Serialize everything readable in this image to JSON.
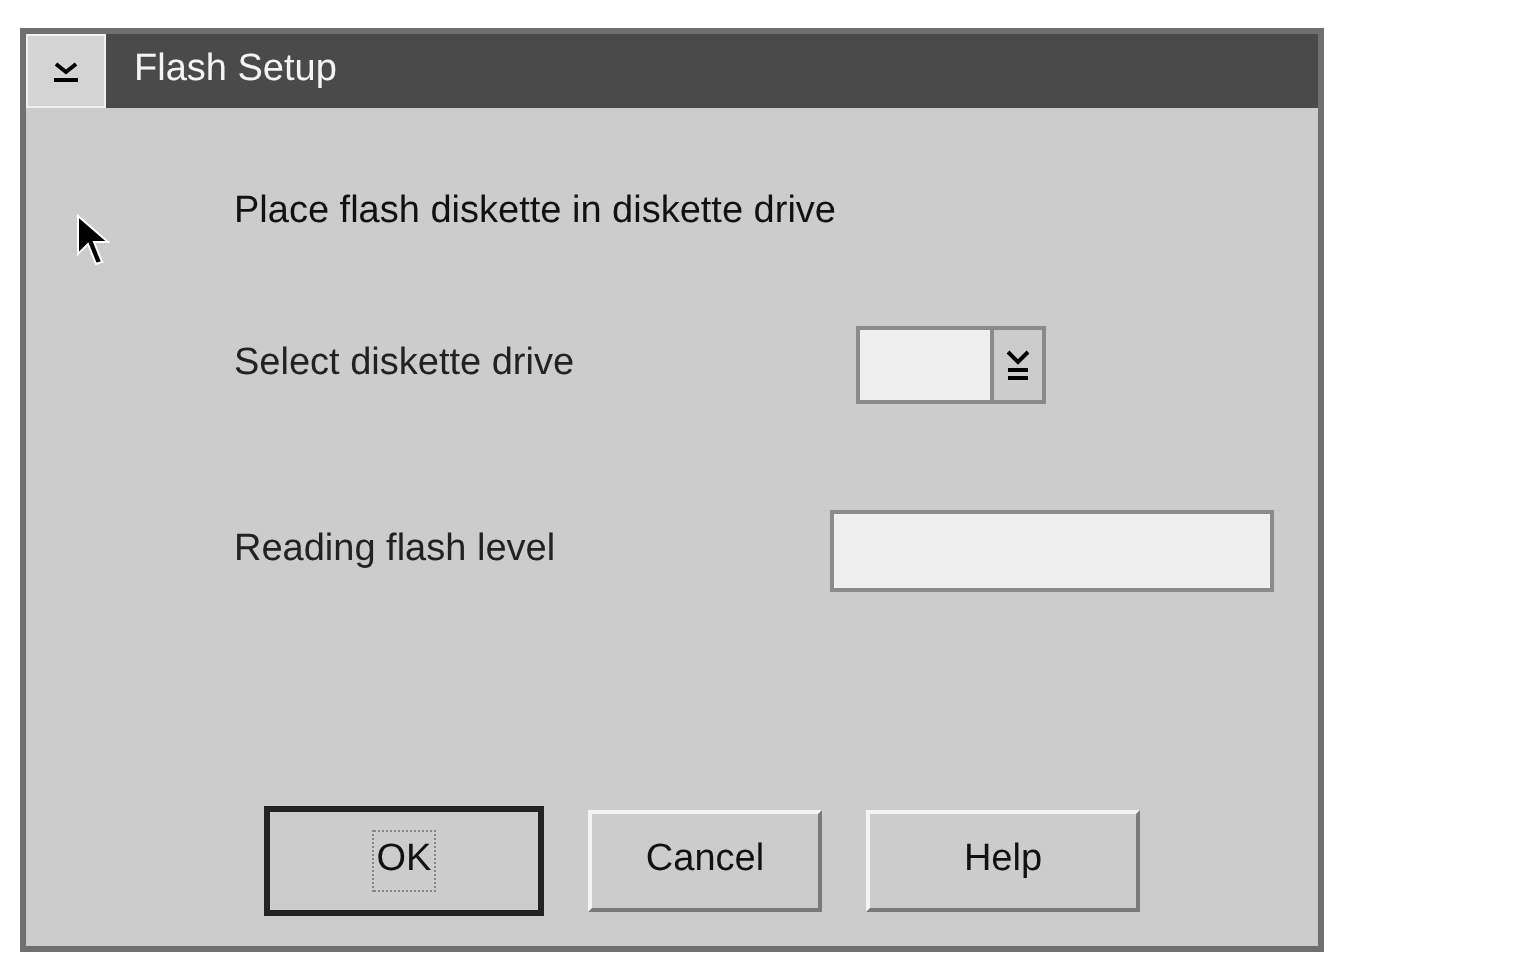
{
  "window": {
    "title": "Flash Setup"
  },
  "message": "Place flash diskette in diskette drive",
  "fields": [
    {
      "kind": "dropdown",
      "label": "Select diskette drive"
    },
    {
      "kind": "text",
      "label": "Reading flash level"
    }
  ],
  "buttons": [
    {
      "label": "OK",
      "default": true
    },
    {
      "label": "Cancel",
      "default": false
    },
    {
      "label": "Help",
      "default": false
    }
  ]
}
